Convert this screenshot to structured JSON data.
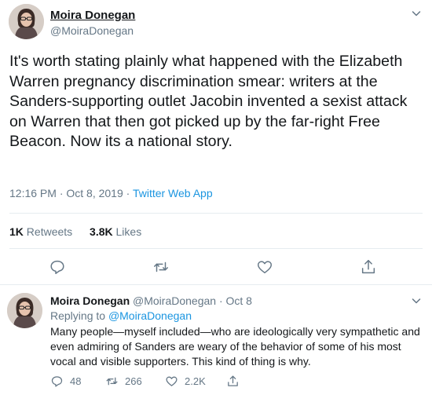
{
  "main_tweet": {
    "author_name": "Moira Donegan",
    "author_handle": "@MoiraDonegan",
    "text": "It's worth stating plainly what happened with the Elizabeth Warren pregnancy discrimination smear: writers at the Sanders-supporting outlet Jacobin invented a sexist attack on Warren that then got picked up by the far-right Free Beacon. Now its a national story.",
    "time": "12:16 PM · Oct 8, 2019 · ",
    "app": "Twitter Web App",
    "retweets_count": "1K",
    "retweets_label": "Retweets",
    "likes_count": "3.8K",
    "likes_label": "Likes",
    "icons": [
      "chevron-down-icon",
      "reply-icon",
      "retweet-icon",
      "like-icon",
      "share-icon"
    ]
  },
  "reply_tweet": {
    "author_name": "Moira Donegan",
    "author_handle": "@MoiraDonegan",
    "date": "Oct 8",
    "replying_prefix": "Replying to",
    "replying_to": "@MoiraDonegan",
    "text": "Many people—myself included—who are ideologically very sympathetic and even admiring of Sanders are weary of the behavior of some of his most vocal and visible supporters. This kind of thing is why.",
    "reply_count": "48",
    "retweet_count": "266",
    "like_count": "2.2K"
  },
  "colors": {
    "text": "#14171a",
    "secondary": "#657786",
    "link": "#1b95e0",
    "divider": "#e6ecf0"
  }
}
